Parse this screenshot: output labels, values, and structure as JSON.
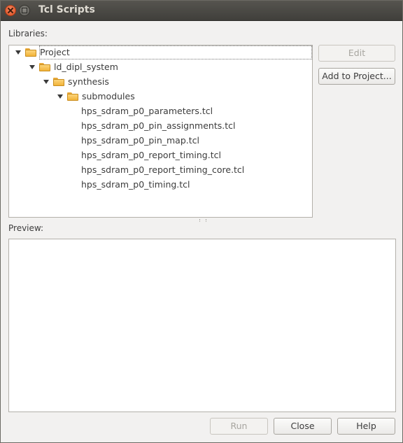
{
  "window": {
    "title": "Tcl Scripts"
  },
  "libraries": {
    "label": "Libraries:",
    "tree": [
      {
        "label": "Project",
        "level": 0,
        "expanded": true,
        "type": "folder",
        "selected": true
      },
      {
        "label": "ld_dipl_system",
        "level": 1,
        "expanded": true,
        "type": "folder"
      },
      {
        "label": "synthesis",
        "level": 2,
        "expanded": true,
        "type": "folder"
      },
      {
        "label": "submodules",
        "level": 3,
        "expanded": true,
        "type": "folder"
      },
      {
        "label": "hps_sdram_p0_parameters.tcl",
        "level": 4,
        "type": "file"
      },
      {
        "label": "hps_sdram_p0_pin_assignments.tcl",
        "level": 4,
        "type": "file"
      },
      {
        "label": "hps_sdram_p0_pin_map.tcl",
        "level": 4,
        "type": "file"
      },
      {
        "label": "hps_sdram_p0_report_timing.tcl",
        "level": 4,
        "type": "file"
      },
      {
        "label": "hps_sdram_p0_report_timing_core.tcl",
        "level": 4,
        "type": "file"
      },
      {
        "label": "hps_sdram_p0_timing.tcl",
        "level": 4,
        "type": "file"
      }
    ]
  },
  "side_buttons": {
    "edit": "Edit",
    "add_to_project": "Add to Project..."
  },
  "preview": {
    "label": "Preview:",
    "content": ""
  },
  "footer": {
    "run": "Run",
    "close": "Close",
    "help": "Help"
  }
}
